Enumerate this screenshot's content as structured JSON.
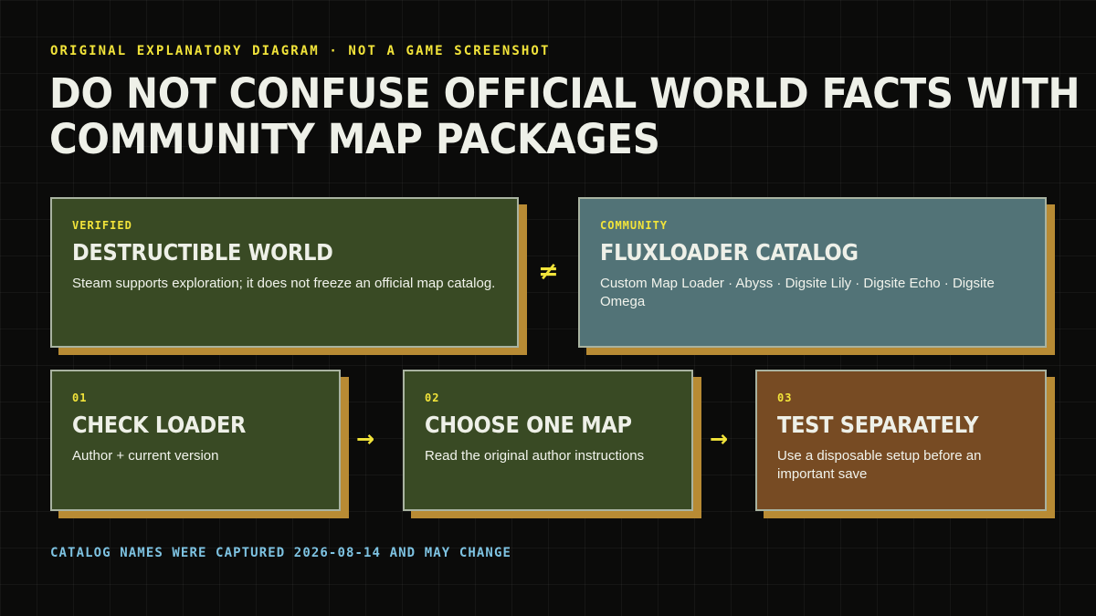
{
  "eyebrow": "ORIGINAL EXPLANATORY DIAGRAM · NOT A GAME SCREENSHOT",
  "title": {
    "line1": "DO NOT CONFUSE OFFICIAL WORLD FACTS WITH",
    "line2": "COMMUNITY MAP PACKAGES"
  },
  "comparison": {
    "left": {
      "tag": "VERIFIED",
      "title": "DESTRUCTIBLE WORLD",
      "description": "Steam supports exploration; it does not freeze an official map catalog.",
      "color": "#394a24"
    },
    "separator": "≠",
    "right": {
      "tag": "COMMUNITY",
      "title": "FLUXLOADER CATALOG",
      "description": "Custom Map Loader · Abyss · Digsite Lily · Digsite Echo · Digsite Omega",
      "color": "#527377"
    }
  },
  "steps": [
    {
      "number": "01",
      "title": "CHECK LOADER",
      "description": "Author + current version",
      "color": "#394a24"
    },
    {
      "number": "02",
      "title": "CHOOSE ONE MAP",
      "description": "Read the original author instructions",
      "color": "#394a24"
    },
    {
      "number": "03",
      "title": "TEST SEPARATELY",
      "description": "Use a disposable setup before an important save",
      "color": "#774b23"
    }
  ],
  "arrow": "→",
  "footnote": "CATALOG NAMES WERE CAPTURED 2026-08-14 AND MAY CHANGE",
  "colors": {
    "background": "#0b0b0a",
    "accent_yellow": "#f2e43a",
    "shadow_gold": "#b88b34",
    "footnote_blue": "#7ec3e2"
  }
}
